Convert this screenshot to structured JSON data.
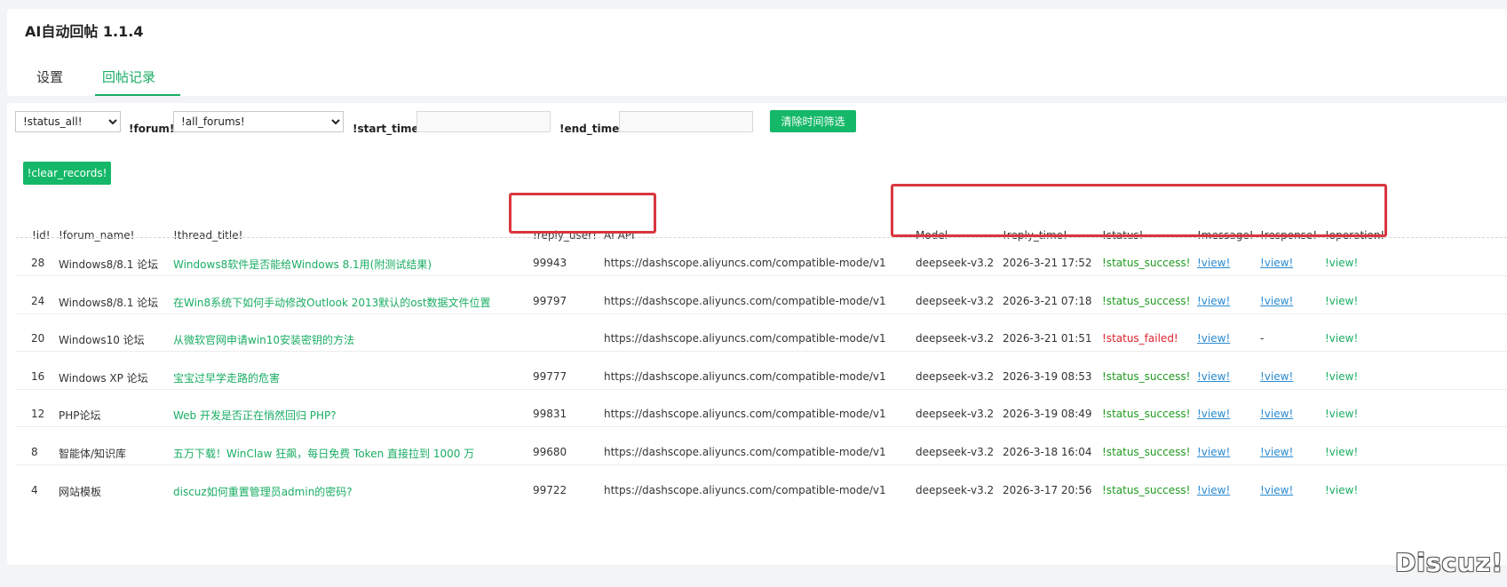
{
  "app": {
    "title": "AI自动回帖 1.1.4"
  },
  "tabs": [
    {
      "label": "设置"
    },
    {
      "label": "回帖记录"
    }
  ],
  "filters": {
    "status_select": "!status_all!",
    "forum_label": "!forum!",
    "forum_select": "!all_forums!",
    "start_label": "!start_time!",
    "start_value": "",
    "end_label": "!end_time!",
    "end_value": "",
    "clear_time_button": "清除时间筛选",
    "clear_records_button": "!clear_records!"
  },
  "table": {
    "headers": {
      "id": "!id!",
      "forum_name": "!forum_name!",
      "thread_title": "!thread_title!",
      "reply_user": "!reply_user!",
      "ai_api": "AI API",
      "model": "Model",
      "reply_time": "!reply_time!",
      "status": "!status!",
      "message": "!message!",
      "response": "!response!",
      "operation": "!operation!"
    },
    "rows": [
      {
        "id": "28",
        "forum": "Windows8/8.1 论坛",
        "title": "Windows8软件是否能给Windows 8.1用(附测试结果)",
        "user": "99943",
        "api": "https://dashscope.aliyuncs.com/compatible-mode/v1",
        "model": "deepseek-v3.2",
        "time": "2026-3-21 17:52",
        "status": "!status_success!",
        "status_type": "success",
        "message": "!view!",
        "response": "!view!",
        "operation": "!view!"
      },
      {
        "id": "24",
        "forum": "Windows8/8.1 论坛",
        "title": "在Win8系统下如何手动修改Outlook 2013默认的ost数据文件位置",
        "user": "99797",
        "api": "https://dashscope.aliyuncs.com/compatible-mode/v1",
        "model": "deepseek-v3.2",
        "time": "2026-3-21 07:18",
        "status": "!status_success!",
        "status_type": "success",
        "message": "!view!",
        "response": "!view!",
        "operation": "!view!"
      },
      {
        "id": "20",
        "forum": "Windows10 论坛",
        "title": "从微软官网申请win10安装密钥的方法",
        "user": "",
        "api": "https://dashscope.aliyuncs.com/compatible-mode/v1",
        "model": "deepseek-v3.2",
        "time": "2026-3-21 01:51",
        "status": "!status_failed!",
        "status_type": "failed",
        "message": "!view!",
        "response": "-",
        "operation": "!view!"
      },
      {
        "id": "16",
        "forum": "Windows XP 论坛",
        "title": "宝宝过早学走路的危害",
        "user": "99777",
        "api": "https://dashscope.aliyuncs.com/compatible-mode/v1",
        "model": "deepseek-v3.2",
        "time": "2026-3-19 08:53",
        "status": "!status_success!",
        "status_type": "success",
        "message": "!view!",
        "response": "!view!",
        "operation": "!view!"
      },
      {
        "id": "12",
        "forum": "PHP论坛",
        "title": "Web 开发是否正在悄然回归 PHP?",
        "user": "99831",
        "api": "https://dashscope.aliyuncs.com/compatible-mode/v1",
        "model": "deepseek-v3.2",
        "time": "2026-3-19 08:49",
        "status": "!status_success!",
        "status_type": "success",
        "message": "!view!",
        "response": "!view!",
        "operation": "!view!"
      },
      {
        "id": "8",
        "forum": "智能体/知识库",
        "title": "五万下载！WinClaw 狂飙，每日免费 Token 直接拉到 1000 万",
        "user": "99680",
        "api": "https://dashscope.aliyuncs.com/compatible-mode/v1",
        "model": "deepseek-v3.2",
        "time": "2026-3-18 16:04",
        "status": "!status_success!",
        "status_type": "success",
        "message": "!view!",
        "response": "!view!",
        "operation": "!view!"
      },
      {
        "id": "4",
        "forum": "网站模板",
        "title": "discuz如何重置管理员admin的密码?",
        "user": "99722",
        "api": "https://dashscope.aliyuncs.com/compatible-mode/v1",
        "model": "deepseek-v3.2",
        "time": "2026-3-17 20:56",
        "status": "!status_success!",
        "status_type": "success",
        "message": "!view!",
        "response": "!view!",
        "operation": "!view!"
      }
    ]
  },
  "watermark": "Discuz!",
  "colors": {
    "accent": "#1aad63",
    "button": "#14b868",
    "success": "#1f9b1f",
    "failed": "#e0222e",
    "highlight": "#d9363e"
  }
}
